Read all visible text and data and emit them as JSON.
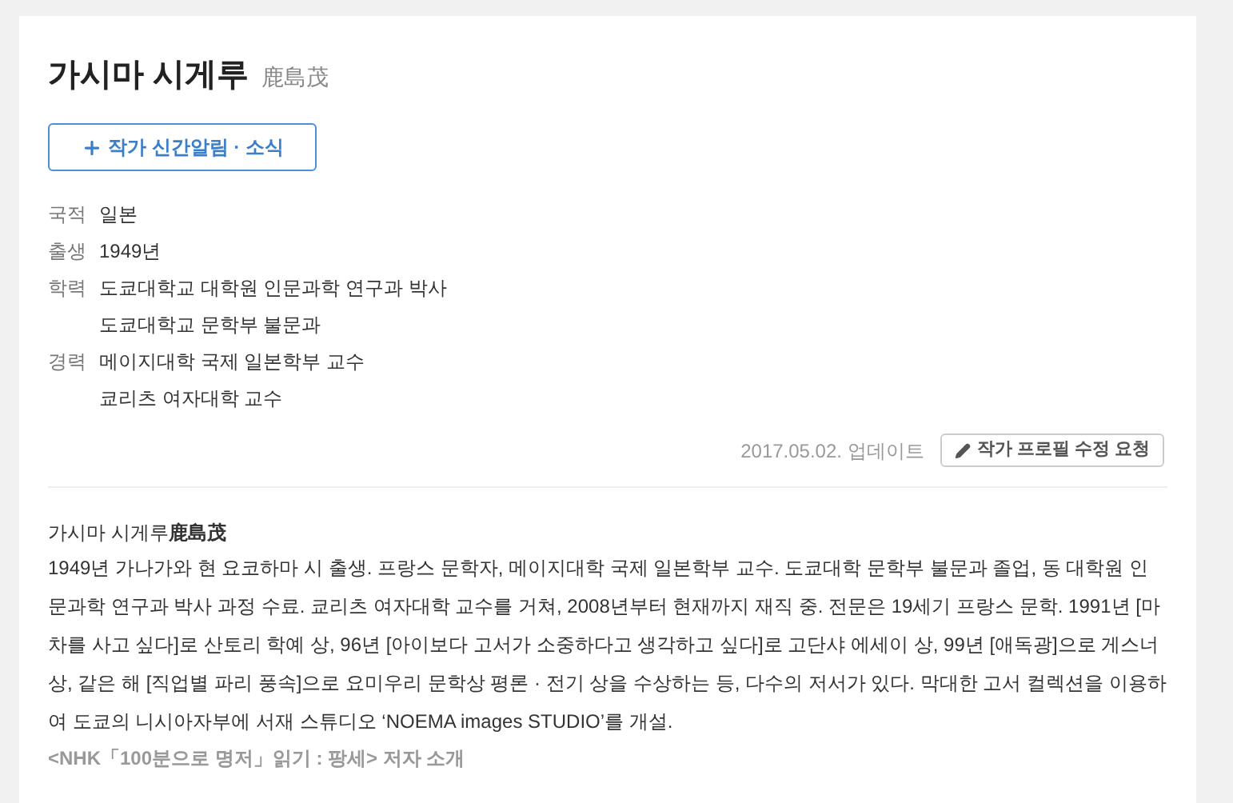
{
  "author": {
    "name": "가시마 시게루",
    "original_name": "鹿島茂"
  },
  "follow_button": {
    "label": "작가 신간알림 · 소식"
  },
  "info": [
    {
      "label": "국적",
      "values": [
        "일본"
      ]
    },
    {
      "label": "출생",
      "values": [
        "1949년"
      ]
    },
    {
      "label": "학력",
      "values": [
        "도쿄대학교 대학원 인문과학 연구과 박사",
        "도쿄대학교 문학부 불문과"
      ]
    },
    {
      "label": "경력",
      "values": [
        "메이지대학 국제 일본학부 교수",
        "쿄리츠 여자대학 교수"
      ]
    }
  ],
  "updated": "2017.05.02. 업데이트",
  "edit_button": {
    "label": "작가 프로필 수정 요청"
  },
  "bio": {
    "heading": "가시마 시게루**鹿島茂**",
    "text": "1949년 가나가와 현 요코하마 시 출생. 프랑스 문학자, 메이지대학 국제 일본학부 교수. 도쿄대학 문학부 불문과 졸업, 동 대학원 인문과학 연구과 박사 과정 수료. 쿄리츠 여자대학 교수를 거쳐, 2008년부터 현재까지 재직 중. 전문은 19세기 프랑스 문학. 1991년 [마차를 사고 싶다]로 산토리 학예 상, 96년 [아이보다 고서가 소중하다고 생각하고 싶다]로 고단샤 에세이 상, 99년 [애독광]으로 게스너 상, 같은 해 [직업별 파리 풍속]으로 요미우리 문학상 평론 · 전기 상을 수상하는 등, 다수의 저서가 있다. 막대한 고서 컬렉션을 이용하여 도쿄의 니시아자부에 서재 스튜디오 ‘NOEMA images STUDIO’를 개설.",
    "source": "<NHK「100분으로 명저」읽기 : 팡세> 저자 소개"
  }
}
